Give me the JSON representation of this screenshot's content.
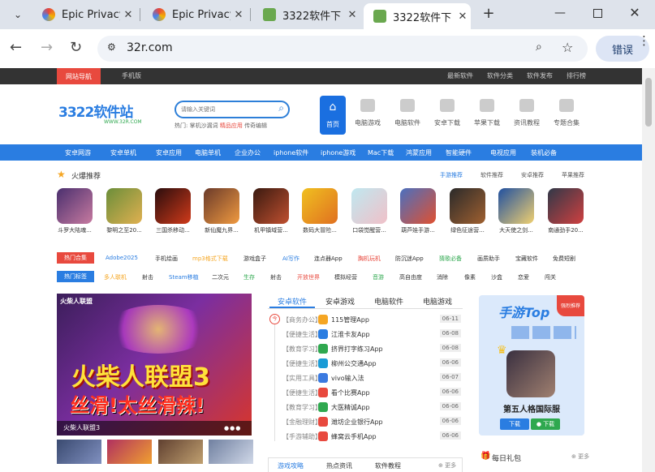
{
  "browser": {
    "tabs": [
      {
        "title": "Epic Privacy",
        "favicon_color": "#e8453c"
      },
      {
        "title": "Epic Privacy",
        "favicon_color": "#e8453c"
      },
      {
        "title": "3322软件下",
        "favicon_color": "#6aa84f"
      },
      {
        "title": "3322软件下",
        "favicon_color": "#6aa84f",
        "active": true
      }
    ],
    "new_tab": "+",
    "url": "32r.com",
    "error_label": "错误"
  },
  "site": {
    "top_strip": {
      "tag": "网站导航",
      "mobile": "手机版",
      "right_links": [
        "最新软件",
        "软件分类",
        "软件发布",
        "排行榜"
      ]
    },
    "logo": {
      "text": "3322软件站",
      "sub": "WWW.32R.COM"
    },
    "search": {
      "placeholder": "请输入关键词",
      "hot_label": "热门:",
      "hot_terms": [
        "掌机沙漏词",
        "精品应用",
        "传奇编辑"
      ]
    },
    "nav_icons": [
      {
        "label": "首页"
      },
      {
        "label": "电脑游戏"
      },
      {
        "label": "电脑软件"
      },
      {
        "label": "安卓下载"
      },
      {
        "label": "苹果下载"
      },
      {
        "label": "资讯教程"
      },
      {
        "label": "专题合集"
      }
    ],
    "blue_bar": [
      "安卓网游",
      "安卓单机",
      "安卓应用",
      "电脑单机",
      "企业办公",
      "iphone软件",
      "iphone游戏",
      "Mac下载",
      "鸿蒙应用",
      "智能硬件",
      "电视应用",
      "装机必备"
    ],
    "hot_section": {
      "title": "火爆推荐",
      "tabs": [
        "手游推荐",
        "软件推荐",
        "安卓推荐",
        "苹果推荐"
      ],
      "apps": [
        "斗罗大陆魂...",
        "黎明之至20...",
        "三国杀移动...",
        "新仙魔九界...",
        "机甲镇域营...",
        "数码大冒险...",
        "口袋觉醒营...",
        "葫芦娃手游...",
        "绿色征途营...",
        "大天使之剑...",
        "南通劲手20..."
      ]
    },
    "tag_rows": [
      {
        "badge": "热门合集",
        "badge_color": "#e8493e",
        "items": [
          "Adobe2025",
          "手机绘画",
          "mp3格式下载",
          "游戏盒子",
          "AI写作",
          "连点器App",
          "胸机玩机",
          "防沉迷App",
          "猜歌必备",
          "画质助手",
          "宝藏软件",
          "免费短剧"
        ]
      },
      {
        "badge": "热门标签",
        "badge_color": "#2a7de1",
        "items": [
          "多人联机",
          "射击",
          "Steam移植",
          "二次元",
          "生存",
          "射击",
          "开放世界",
          "模拟经营",
          "音游",
          "高自由度",
          "消除",
          "像素",
          "沙盒",
          "恋爱",
          "闯关"
        ]
      }
    ],
    "banner": {
      "title": "火柴人联盟3",
      "line1": "火柴人联盟3",
      "line2": "丝滑!太丝滑辣!",
      "caption": "火柴人联盟3",
      "logo_text": "火柴人联盟"
    },
    "list_tabs": [
      "安卓软件",
      "安卓游戏",
      "电脑软件",
      "电脑游戏"
    ],
    "list_items": [
      {
        "cat": "【商务办公】",
        "name": "115管理App",
        "date": "06-11",
        "color": "#f5a623"
      },
      {
        "cat": "【便捷生活】",
        "name": "江淮卡友App",
        "date": "06-08",
        "color": "#2a7de1"
      },
      {
        "cat": "【教育学习】",
        "name": "挤界打字练习App",
        "date": "06-08",
        "color": "#2fa84f"
      },
      {
        "cat": "【便捷生活】",
        "name": "柳州公交通App",
        "date": "06-06",
        "color": "#1a9bd6"
      },
      {
        "cat": "【实用工具】",
        "name": "vivo输入法",
        "date": "06-07",
        "color": "#3b7ae0"
      },
      {
        "cat": "【便捷生活】",
        "name": "看个比赛App",
        "date": "06-06",
        "color": "#e8493e"
      },
      {
        "cat": "【教育学习】",
        "name": "大医精诚App",
        "date": "06-06",
        "color": "#2fa84f"
      },
      {
        "cat": "【金融理财】",
        "name": "潍坊企业银行App",
        "date": "06-06",
        "color": "#e8493e"
      },
      {
        "cat": "【手游辅助】",
        "name": "蜂窝云手机App",
        "date": "06-06",
        "color": "#e8493e"
      }
    ],
    "top_card": {
      "title": "手游Top",
      "ribbon": "强烈推荐",
      "game": "第五人格国际服",
      "btn_android": "下载",
      "btn_ios": "下载"
    },
    "bottom_tabs": [
      "游戏攻略",
      "热点资讯",
      "软件教程"
    ],
    "more": "更多",
    "gift": "每日礼包",
    "gift_more": "更多"
  }
}
